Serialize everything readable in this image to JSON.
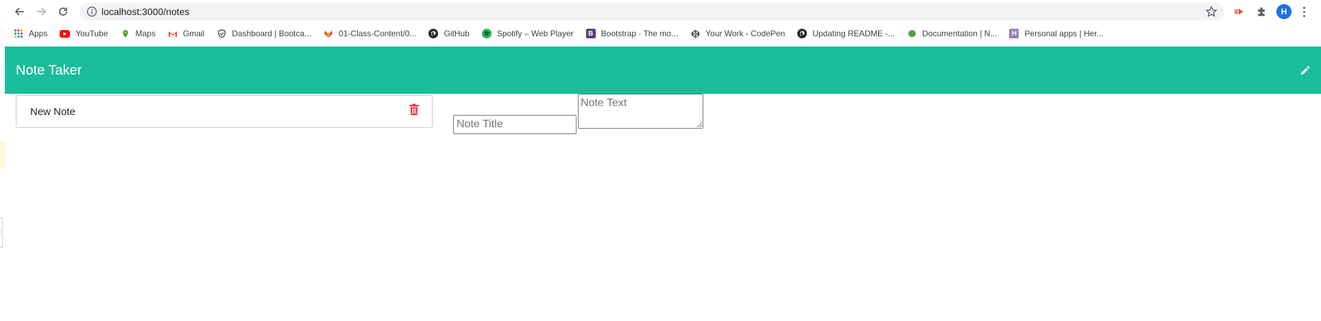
{
  "browser": {
    "url": "localhost:3000/notes",
    "avatar_letter": "H",
    "bookmarks": [
      {
        "label": "Apps",
        "icon": "apps-grid-icon",
        "color": "#4285f4"
      },
      {
        "label": "YouTube",
        "icon": "youtube-icon",
        "color": "#ff0000"
      },
      {
        "label": "Maps",
        "icon": "maps-pin-icon",
        "color": "#34a853"
      },
      {
        "label": "Gmail",
        "icon": "gmail-icon",
        "color": "#ea4335"
      },
      {
        "label": "Dashboard | Bootca...",
        "icon": "shield-check-icon",
        "color": "#3c4a5c"
      },
      {
        "label": "01-Class-Content/0...",
        "icon": "gitlab-icon",
        "color": "#e24329"
      },
      {
        "label": "GitHub",
        "icon": "github-icon",
        "color": "#24292e"
      },
      {
        "label": "Spotify – Web Player",
        "icon": "spotify-icon",
        "color": "#1db954"
      },
      {
        "label": "Bootstrap · The mo...",
        "icon": "bootstrap-icon",
        "color": "#563d7c"
      },
      {
        "label": "Your Work - CodePen",
        "icon": "codepen-icon",
        "color": "#111111"
      },
      {
        "label": "Updating README -...",
        "icon": "github-icon",
        "color": "#24292e"
      },
      {
        "label": "Documentation | N...",
        "icon": "nodejs-icon",
        "color": "#539e43"
      },
      {
        "label": "Personal apps | Her...",
        "icon": "heroku-icon",
        "color": "#9e7cc1"
      }
    ]
  },
  "app": {
    "brand": "Note Taker",
    "accent_color": "#1abc9c",
    "notes": [
      {
        "title": "New Note"
      }
    ],
    "note_title_placeholder": "Note Title",
    "note_text_placeholder": "Note Text",
    "delete_color": "#dc3545"
  }
}
